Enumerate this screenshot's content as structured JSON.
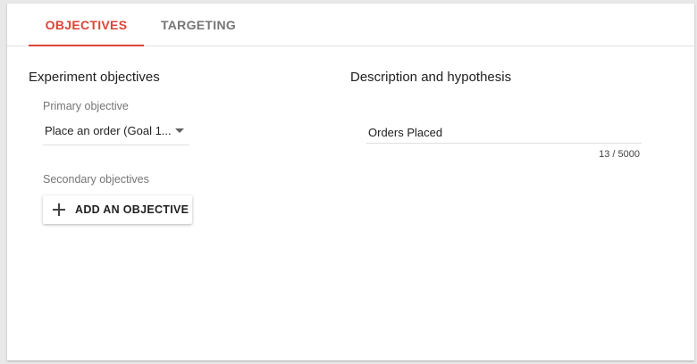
{
  "tabs": [
    {
      "label": "OBJECTIVES",
      "active": true
    },
    {
      "label": "TARGETING",
      "active": false
    }
  ],
  "objectives": {
    "title": "Experiment objectives",
    "primary_label": "Primary objective",
    "primary_value": "Place an order (Goal 1...",
    "secondary_label": "Secondary objectives",
    "add_button_label": "ADD AN OBJECTIVE"
  },
  "description": {
    "title": "Description and hypothesis",
    "value": "Orders Placed",
    "counter": "13 / 5000"
  },
  "colors": {
    "accent": "#db4437",
    "inactive_tab": "#757575"
  },
  "icons": {
    "dropdown": "dropdown-caret-icon",
    "add": "plus-icon"
  }
}
